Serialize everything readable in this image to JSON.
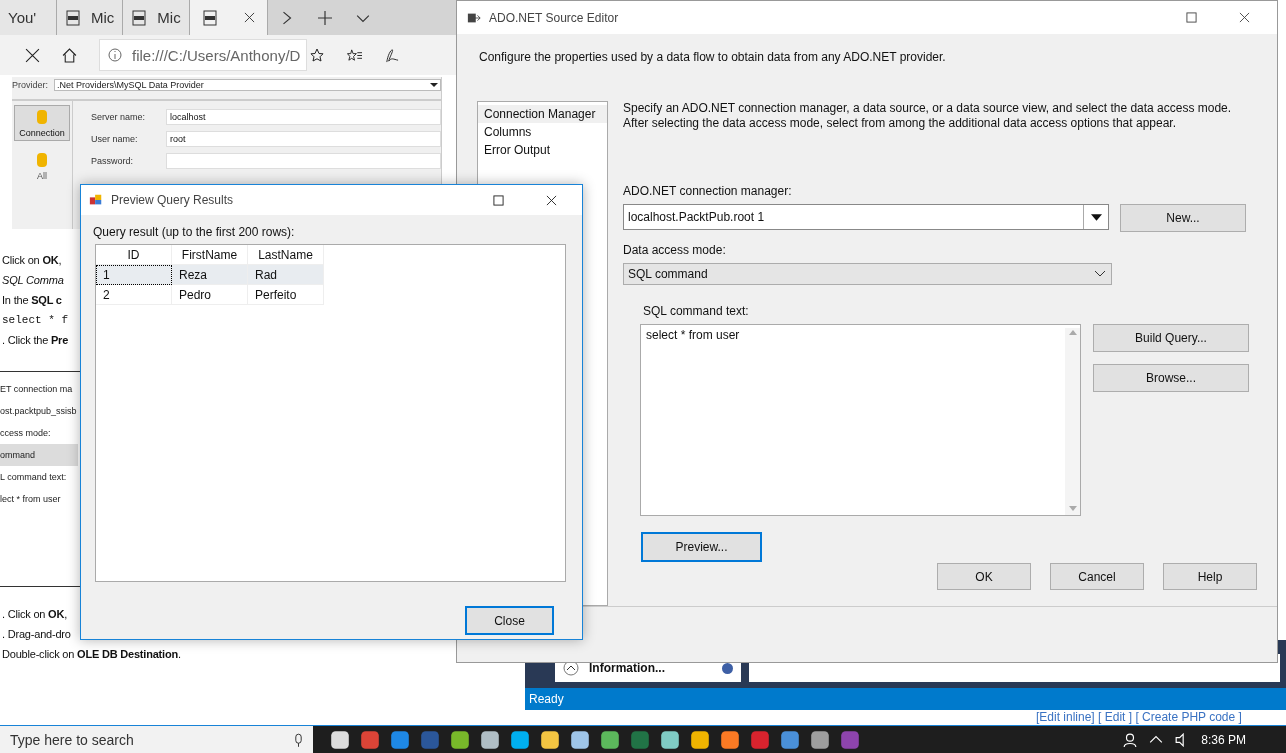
{
  "browser": {
    "tabs": [
      {
        "label": "You'",
        "kind": "page",
        "selected": false
      },
      {
        "label": "Mic",
        "kind": "pdf",
        "selected": false
      },
      {
        "label": "Mic",
        "kind": "pdf",
        "selected": false
      },
      {
        "kind": "pdf",
        "selected": true
      }
    ],
    "address": "file:///C:/Users/Anthony/D",
    "document": {
      "shot1": {
        "provider_label": "Provider:",
        "provider": ".Net Providers\\MySQL Data Provider",
        "sections": [
          {
            "label": "Connection",
            "selected": true
          },
          {
            "label": "All",
            "selected": false
          }
        ],
        "fields": [
          {
            "label": "Server name:",
            "value": "localhost"
          },
          {
            "label": "User name:",
            "value": "root"
          },
          {
            "label": "Password:"
          }
        ]
      },
      "lines_a": [
        {
          "text": "Click on **OK**,",
          "kind": "para"
        },
        {
          "text": "*SQL Comma*",
          "kind": "para"
        },
        {
          "text": "In the **SQL c**",
          "kind": "para"
        },
        {
          "text": "select * f",
          "kind": "code"
        },
        {
          "text": ". Click the **Pre**",
          "kind": "para"
        }
      ],
      "shot2": [
        "ET connection ma",
        "ost.packtpub_ssisb",
        "ccess mode:",
        "ommand",
        "L command text:",
        "lect * from user"
      ],
      "lines_b": [
        {
          "text": ". Click on **OK**,",
          "kind": "para"
        },
        {
          "text": ". Drag-and-dro",
          "kind": "para"
        },
        {
          "text": "Double-click on **OLE DB Destination**.",
          "kind": "para"
        }
      ]
    }
  },
  "background_window": {
    "panel": "Information...",
    "status": "Ready",
    "links": "[Edit inline] [ Edit ] [ Create PHP code ]"
  },
  "editor": {
    "title": "ADO.NET Source Editor",
    "description": "Configure the properties used by a data flow to obtain data from any ADO.NET provider.",
    "nav": [
      {
        "label": "Connection Manager",
        "selected": true
      },
      {
        "label": "Columns",
        "selected": false
      },
      {
        "label": "Error Output",
        "selected": false
      }
    ],
    "help": "Specify an ADO.NET connection manager, a data source, or a data source view, and select the data access mode. After selecting the data access mode, select from among the additional data access options that appear.",
    "connection_label": "ADO.NET connection manager:",
    "connection": "localhost.PacktPub.root 1",
    "new_button": "New...",
    "mode_label": "Data access mode:",
    "mode": "SQL command",
    "sql_label": "SQL command text:",
    "sql": "select * from user",
    "build_button": "Build Query...",
    "browse_button": "Browse...",
    "preview_button": "Preview...",
    "buttons": [
      "OK",
      "Cancel",
      "Help"
    ]
  },
  "preview": {
    "title": "Preview Query Results",
    "label": "Query result (up to the first 200 rows):",
    "columns": [
      "ID",
      "FirstName",
      "LastName"
    ],
    "rows": [
      {
        "cells": [
          "1",
          "Reza",
          "Rad"
        ],
        "selected": true
      },
      {
        "cells": [
          "2",
          "Pedro",
          "Perfeito"
        ],
        "selected": false
      }
    ],
    "close": "Close"
  },
  "taskbar": {
    "search": "Type here to search",
    "apps": [
      {
        "color": "#dddddd"
      },
      {
        "color": "#db4437"
      },
      {
        "color": "#1e88e5"
      },
      {
        "color": "#2b579a"
      },
      {
        "color": "#78b82a"
      },
      {
        "color": "#b0bec5"
      },
      {
        "color": "#00aff0"
      },
      {
        "color": "#f4c542"
      },
      {
        "color": "#9fc5e8"
      },
      {
        "color": "#5cb85c"
      },
      {
        "color": "#217346"
      },
      {
        "color": "#80cbc4"
      },
      {
        "color": "#f0b400"
      },
      {
        "color": "#fb7a24"
      },
      {
        "color": "#d9232e"
      },
      {
        "color": "#4a90d9"
      },
      {
        "color": "#9e9e9e"
      },
      {
        "color": "#8e44ad"
      }
    ],
    "time": "8:36 PM"
  }
}
